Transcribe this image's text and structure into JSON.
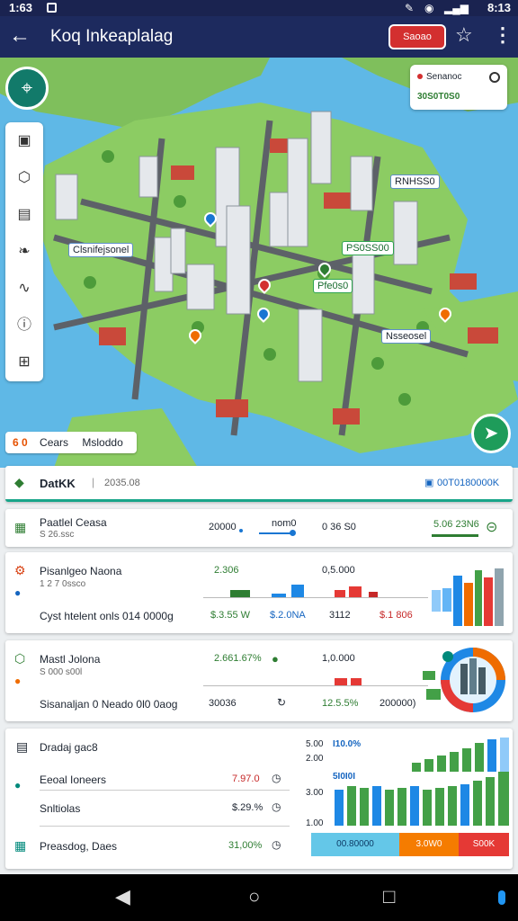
{
  "status_bar": {
    "time": "1:63",
    "right": "8:13"
  },
  "app_bar": {
    "title": "Koq Inkeaplalag",
    "cta_label": "Saoao",
    "back_icon": "arrow-left-icon",
    "star_icon": "star-icon",
    "more_icon": "more-vert-icon"
  },
  "map": {
    "legend": {
      "item1": "Senanoc",
      "item2": "30S0T0S0"
    },
    "labels": [
      "Clsnifejsonel",
      "PS0SS00",
      "Pfe0s0",
      "RNHSS0",
      "Nsseosel"
    ],
    "chip": {
      "num": "6 0",
      "text1": "Cears",
      "text2": "Msloddo"
    },
    "tools": [
      "layers-icon",
      "shape-icon",
      "calendar-icon",
      "leaf-icon",
      "route-icon",
      "info-icon",
      "map-icon"
    ]
  },
  "summary": {
    "title": "DatKK",
    "date": "2035.08",
    "right_label": "00T0180000K"
  },
  "card1": {
    "title": "Paatlel Ceasa",
    "subtitle": "S 26.ssc",
    "v1": "20000",
    "v2": "nom0",
    "v3": "0 36 S0",
    "v4": "5.06 23N6"
  },
  "card2": {
    "title": "Pisanlgeo Naona",
    "subtitle": "1 2 7 0ssco",
    "v1": "2.306",
    "v2": "0,5.000",
    "row2_label": "Cyst htelent onls 014 0000g",
    "r1": "$.3.55 W",
    "r2": "$.2.0NA",
    "r3": "3112",
    "r4": "$.1 806"
  },
  "card3": {
    "title": "Mastl Jolona",
    "subtitle": "S 000 s00l",
    "v1": "2.661.67%",
    "v2": "1,0.000",
    "row2_label": "Sisanaljan 0 Neado 0l0 0aog",
    "r1": "30036",
    "r2": "12.5.5%",
    "r3": "200000)"
  },
  "card4": {
    "title": "Dradaj gac8",
    "row1_label": "Eeoal Ioneers",
    "row1_value": "7.97.0",
    "row2_label": "Snltiolas",
    "row2_value": "$.29.%",
    "row3_label": "Preasdog, Daes",
    "row3_value": "31,00%",
    "chart_y1": "5.00",
    "chart_y2": "2.00",
    "chart_y3": "3.00",
    "chart_y4": "1.00",
    "chart_lbl1": "I10.0%",
    "chart_lbl2": "5I0I0I",
    "seg1": "00.80000",
    "seg2": "3.0W0",
    "seg3": "S00K"
  },
  "colors": {
    "appbar": "#1d2a5e",
    "accent": "#d32f2f",
    "green": "#2e7d32",
    "teal": "#127a6a"
  }
}
